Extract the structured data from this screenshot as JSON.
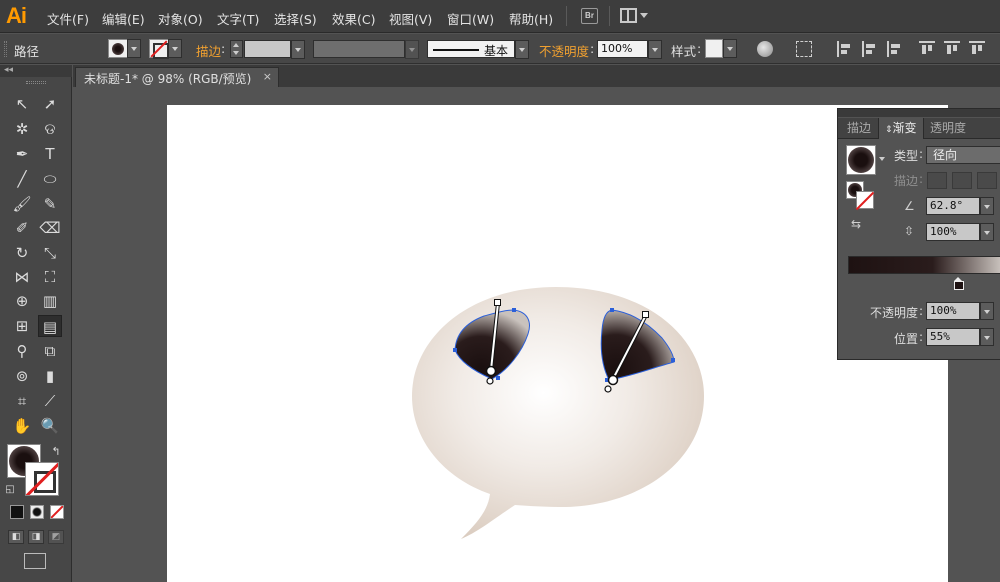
{
  "app": {
    "logo": "Ai",
    "br_label": "Br"
  },
  "menu": [
    "文件(F)",
    "编辑(E)",
    "对象(O)",
    "文字(T)",
    "选择(S)",
    "效果(C)",
    "视图(V)",
    "窗口(W)",
    "帮助(H)"
  ],
  "control": {
    "selection_label": "路径",
    "stroke_label": "描边",
    "stroke_style_label": "基本",
    "opacity_label": "不透明度",
    "opacity_value": "100%",
    "style_label": "样式"
  },
  "tools_panel": {
    "collapse": "◂◂"
  },
  "document": {
    "tab_title": "未标题-1* @ 98% (RGB/预览)",
    "close": "×"
  },
  "gradient_panel": {
    "tabs": [
      "描边",
      "渐变",
      "透明度"
    ],
    "active_tab": "渐变",
    "type_label": "类型",
    "type_value": "径向",
    "stroke_label": "描边",
    "angle_value": "62.8°",
    "aspect_value": "100%",
    "opacity_label": "不透明度",
    "opacity_value": "100%",
    "location_label": "位置",
    "location_value": "55%"
  },
  "colors": {
    "menubar": "#3d3d3d",
    "panel": "#474747",
    "accent_orange": "#f0a030",
    "gradient_dark": "#1e1212",
    "bubble_light": "#ffffff",
    "bubble_edge": "#d9cabd",
    "selection_blue": "#2b5fd9"
  }
}
